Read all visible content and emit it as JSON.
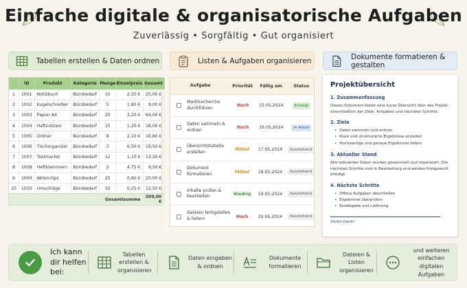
{
  "header": {
    "title": "Einfache digitale & organisatorische Aufgaben",
    "subtitle": "Zuverlässig • Sorgfältig • Gut organisiert"
  },
  "sections": {
    "tables": "Tabellen erstellen & Daten ordnen",
    "lists": "Listen & Aufgaben organisieren",
    "docs": "Dokumente formatieren & gestalten"
  },
  "inventory": {
    "headers": [
      "ID",
      "Produkt",
      "Kategorie",
      "Menge",
      "Einzelpreis",
      "Gesamt"
    ],
    "rows": [
      [
        "1",
        "1001",
        "Notizbuch",
        "Bürobedarf",
        "10",
        "2,50 €",
        "25,00 €"
      ],
      [
        "2",
        "1002",
        "Kugelschreiber",
        "Bürobedarf",
        "5",
        "1,80 €",
        "9,00 €"
      ],
      [
        "3",
        "1003",
        "Papier A4",
        "Bürobedarf",
        "20",
        "3,20 €",
        "64,00 €"
      ],
      [
        "4",
        "1004",
        "Haftnotizen",
        "Bürobedarf",
        "15",
        "1,20 €",
        "18,00 €"
      ],
      [
        "5",
        "1005",
        "Ordner",
        "Bürobedarf",
        "8",
        "2,10 €",
        "16,80 €"
      ],
      [
        "6",
        "1006",
        "Tischorganizer",
        "Bürobedarf",
        "3",
        "6,50 €",
        "19,50 €"
      ],
      [
        "7",
        "1007",
        "Textmarker",
        "Bürobedarf",
        "12",
        "1,10 €",
        "13,20 €"
      ],
      [
        "8",
        "1008",
        "Heftklammern",
        "Bürobedarf",
        "2",
        "4,75 €",
        "9,50 €"
      ],
      [
        "9",
        "1009",
        "Aktenclips",
        "Bürobedarf",
        "25",
        "0,80 €",
        "20,00 €"
      ],
      [
        "10",
        "1010",
        "Umschläge",
        "Bürobedarf",
        "50",
        "0,25 €",
        "12,50 €"
      ]
    ],
    "sum_label": "Gesamtsumme",
    "sum_value": "209,00 €"
  },
  "tasks": {
    "headers": {
      "task": "Aufgabe",
      "priority": "Priorität",
      "due": "Fällig am",
      "status": "Status"
    },
    "rows": [
      {
        "task": "Marktrecherche durchführen",
        "priority": "Hoch",
        "prio_color": "#c0392b",
        "due": "15.05.2024",
        "status": "Erledigt",
        "status_bg": "#dcefd3",
        "status_fg": "#2f7a2a"
      },
      {
        "task": "Daten sammeln & ordnen",
        "priority": "Hoch",
        "prio_color": "#c0392b",
        "due": "16.05.2024",
        "status": "In Arbeit",
        "status_bg": "#dbe7f6",
        "status_fg": "#2c5a93"
      },
      {
        "task": "Übersichtstabelle erstellen",
        "priority": "Mittel",
        "prio_color": "#d98a16",
        "due": "17.05.2024",
        "status": "Ausstehend",
        "status_bg": "#ededed",
        "status_fg": "#555555"
      },
      {
        "task": "Dokument formatieren",
        "priority": "Mittel",
        "prio_color": "#d98a16",
        "due": "18.05.2024",
        "status": "Ausstehend",
        "status_bg": "#ededed",
        "status_fg": "#555555"
      },
      {
        "task": "Inhalte prüfen & bearbeiten",
        "priority": "Niedrig",
        "prio_color": "#3f8f35",
        "due": "19.05.2024",
        "status": "Ausstehend",
        "status_bg": "#ededed",
        "status_fg": "#555555"
      },
      {
        "task": "Dateien fertigstellen & liefern",
        "priority": "Hoch",
        "prio_color": "#c0392b",
        "due": "20.05.2024",
        "status": "Ausstehend",
        "status_bg": "#ededed",
        "status_fg": "#555555"
      }
    ]
  },
  "document": {
    "title": "Projektübersicht",
    "s1_title": "1. Zusammenfassung",
    "s1_text": "Dieses Dokument bietet eine kurze Übersicht über das Projekt, einschließlich der Ziele, Aufgaben und nächsten Schritte.",
    "s2_title": "2. Ziele",
    "s2_items": [
      "Daten sammeln und ordnen",
      "Klare und strukturierte Ergebnisse erstellen",
      "Hochwertige und genaue Ergebnisse liefern"
    ],
    "s3_title": "3. Aktueller Stand",
    "s3_text": "Alle relevanten Daten wurden gesammelt und organisiert. Die nächsten Schritte sind in Bearbeitung und werden fristgerecht erledigt.",
    "s4_title": "4. Nächste Schritte",
    "s4_items": [
      "Offene Aufgaben abschließen",
      "Ergebnisse überprüfen",
      "Endabgabe und Lieferung"
    ],
    "thanks": "Vielen Dank!"
  },
  "bottom": {
    "help": "Ich kann dir helfen bei:",
    "items": [
      {
        "label": "Tabellen erstellen & organisieren",
        "icon": "table-icon"
      },
      {
        "label": "Daten eingeben & ordnen",
        "icon": "document-icon"
      },
      {
        "label": "Dokumente formatieren",
        "icon": "text-format-icon"
      },
      {
        "label": "Dateien & Listen organisieren",
        "icon": "folder-icon"
      },
      {
        "label": "und weiteren einfachen digitalen Aufgaben",
        "icon": "more-icon"
      }
    ]
  },
  "colors": {
    "accent_green": "#4b9b45",
    "table_header": "#a9cf8e",
    "doc_blue": "#2c4d7a"
  }
}
